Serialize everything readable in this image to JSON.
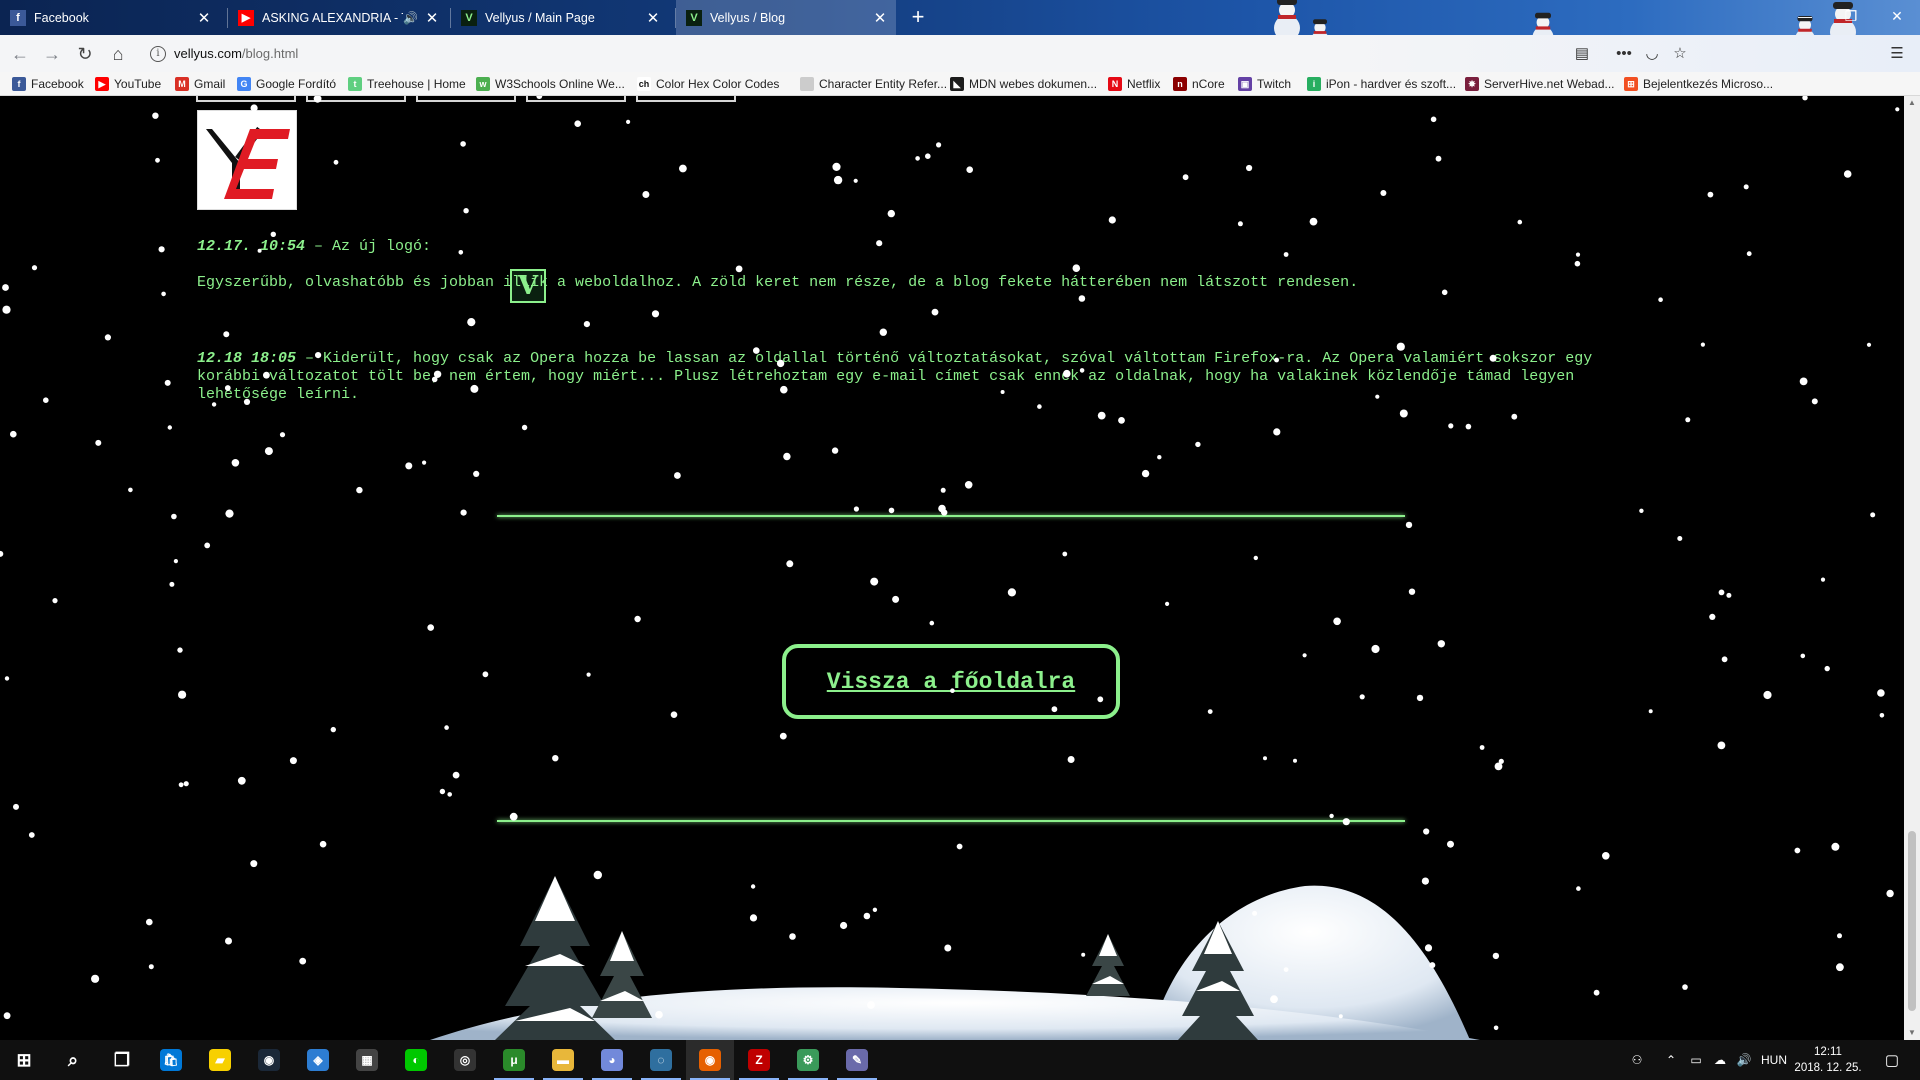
{
  "browser": {
    "tabs": [
      {
        "title": "Facebook",
        "icon": "facebook-icon",
        "color": "#3b5998",
        "glyph": "f",
        "active": false,
        "muted": false
      },
      {
        "title": "ASKING ALEXANDRIA - The",
        "icon": "youtube-icon",
        "color": "#ff0000",
        "glyph": "▶",
        "active": false,
        "muted": true
      },
      {
        "title": "Vellyus / Main Page",
        "icon": "vellyus-icon",
        "color": "#0a2010",
        "glyph": "V",
        "active": false,
        "muted": false
      },
      {
        "title": "Vellyus / Blog",
        "icon": "vellyus-icon",
        "color": "#0a2010",
        "glyph": "V",
        "active": true,
        "muted": false
      }
    ],
    "new_tab_glyph": "+",
    "url": {
      "host": "vellyus.com",
      "path": "/blog.html"
    },
    "bookmarks": [
      {
        "label": "Facebook",
        "icon": "facebook-icon",
        "color": "#3b5998",
        "glyph": "f"
      },
      {
        "label": "YouTube",
        "icon": "youtube-icon",
        "color": "#ff0000",
        "glyph": "▶"
      },
      {
        "label": "Gmail",
        "icon": "gmail-icon",
        "color": "#d93025",
        "glyph": "M"
      },
      {
        "label": "Google Fordító",
        "icon": "translate-icon",
        "color": "#4285f4",
        "glyph": "G"
      },
      {
        "label": "Treehouse | Home",
        "icon": "treehouse-icon",
        "color": "#5fcf80",
        "glyph": "t"
      },
      {
        "label": "W3Schools Online We...",
        "icon": "w3schools-icon",
        "color": "#4caf50",
        "glyph": "w"
      },
      {
        "label": "Color Hex Color Codes",
        "icon": "colorhex-icon",
        "color": "#ffffff",
        "glyph": "ch"
      },
      {
        "label": "Character Entity Refer...",
        "icon": "page-icon",
        "color": "#cccccc",
        "glyph": ""
      },
      {
        "label": "MDN webes dokumen...",
        "icon": "mdn-icon",
        "color": "#1b1b1b",
        "glyph": "◣"
      },
      {
        "label": "Netflix",
        "icon": "netflix-icon",
        "color": "#e50914",
        "glyph": "N"
      },
      {
        "label": "nCore",
        "icon": "ncore-icon",
        "color": "#8b0000",
        "glyph": "n"
      },
      {
        "label": "Twitch",
        "icon": "twitch-icon",
        "color": "#6441a5",
        "glyph": "▣"
      },
      {
        "label": "iPon - hardver és szoft...",
        "icon": "ipon-icon",
        "color": "#27ae60",
        "glyph": "i"
      },
      {
        "label": "ServerHive.net Webad...",
        "icon": "serverhive-icon",
        "color": "#7a1f3d",
        "glyph": "✸"
      },
      {
        "label": "Bejelentkezés Microso...",
        "icon": "microsoft-icon",
        "color": "#f25022",
        "glyph": "⊞"
      }
    ]
  },
  "page": {
    "logo_text": "YE",
    "posts": [
      {
        "stamp": "12.17. 10:54",
        "lines": [
          " – Az új logó:"
        ]
      },
      {
        "stamp": "",
        "lines": [
          "Egyszerűbb, olvashatóbb és jobban illik a weboldalhoz. A zöld keret nem része, de a blog fekete hátterében nem látszott rendesen."
        ]
      },
      {
        "stamp": "12.18 18:05",
        "lines": [
          " – Kiderült, hogy csak az Opera hozza be lassan az oldallal történő változtatásokat, szóval váltottam Firefox-ra. Az Opera valamiért sokszor egy",
          "korábbi változatot tölt be, nem értem, hogy miért... Plusz létrehoztam egy e-mail címet csak ennek az oldalnak, hogy ha valakinek közlendője támad legyen",
          "lehetősége leírni."
        ]
      }
    ],
    "logo_badge": "V",
    "back_button": "Vissza a főoldalra"
  },
  "taskbar": {
    "apps": [
      {
        "name": "start-icon",
        "glyph": "⊞",
        "color": "transparent"
      },
      {
        "name": "search-icon",
        "glyph": "⌕",
        "color": "transparent"
      },
      {
        "name": "task-view-icon",
        "glyph": "❐",
        "color": "transparent"
      },
      {
        "name": "store-icon",
        "glyph": "🛍",
        "color": "#0078d7"
      },
      {
        "name": "sticky-notes-icon",
        "glyph": "▰",
        "color": "#f7d000"
      },
      {
        "name": "steam-icon",
        "glyph": "◉",
        "color": "#1b2838"
      },
      {
        "name": "visual-studio-icon",
        "glyph": "◈",
        "color": "#2d7dd2"
      },
      {
        "name": "calculator-icon",
        "glyph": "▦",
        "color": "#444444"
      },
      {
        "name": "razer-icon",
        "glyph": "◐",
        "color": "#00c800"
      },
      {
        "name": "groove-icon",
        "glyph": "◎",
        "color": "#333333"
      },
      {
        "name": "utorrent-icon",
        "glyph": "μ",
        "color": "#2a8a2a"
      },
      {
        "name": "file-explorer-icon",
        "glyph": "▬",
        "color": "#e8b73a"
      },
      {
        "name": "discord-icon",
        "glyph": "◕",
        "color": "#7289da"
      },
      {
        "name": "logitech-icon",
        "glyph": "◌",
        "color": "#2f6f9f"
      },
      {
        "name": "firefox-icon",
        "glyph": "◉",
        "color": "#e66000"
      },
      {
        "name": "filezilla-icon",
        "glyph": "Z",
        "color": "#bf0000"
      },
      {
        "name": "cheat-engine-icon",
        "glyph": "⚙",
        "color": "#3a9a5a"
      },
      {
        "name": "paint-icon",
        "glyph": "✎",
        "color": "#6a6aaa"
      }
    ],
    "language": "HUN",
    "time": "12:11",
    "date": "2018. 12. 25."
  },
  "colors": {
    "accent": "#8cf08c",
    "background": "#000000"
  }
}
